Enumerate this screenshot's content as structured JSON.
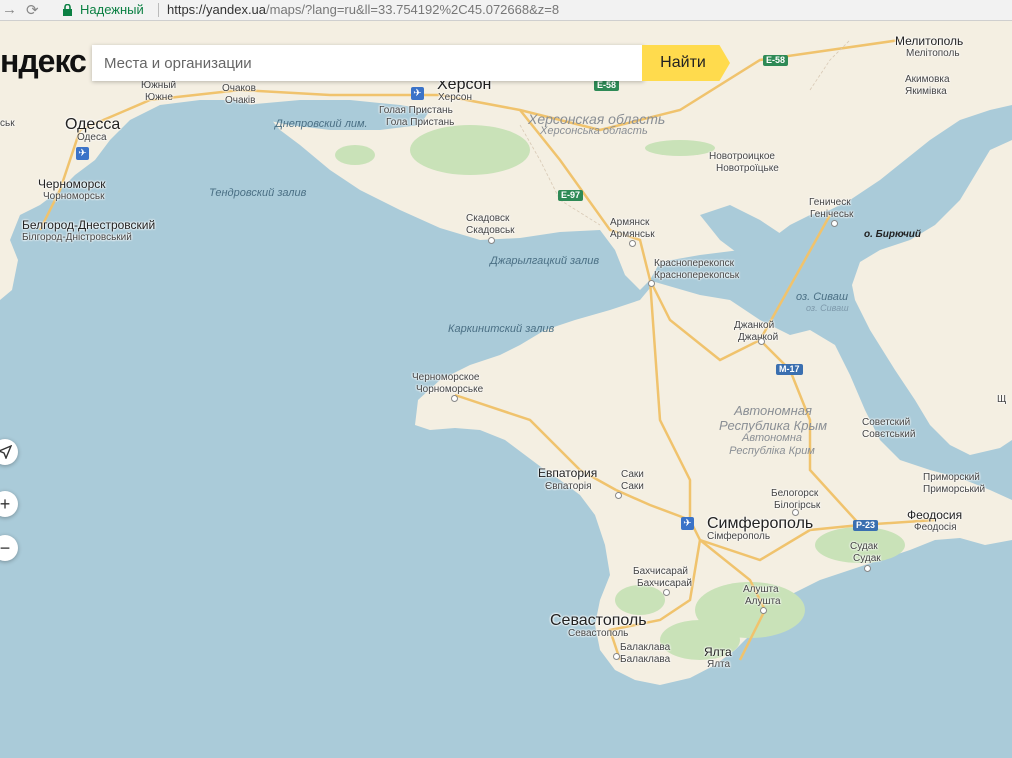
{
  "browser": {
    "security_label": "Надежный",
    "url_host": "https://yandex.ua",
    "url_path": "/maps/?lang=ru&ll=33.754192%2C45.072668&z=8"
  },
  "search": {
    "logo": "ндекс",
    "placeholder": "Места и организации",
    "button_label": "Найти"
  },
  "controls": {
    "geolocate_icon": "arrow-icon",
    "zoom_in_label": "+",
    "zoom_out_label": "−"
  },
  "cities": [
    {
      "name": "Одесса",
      "alt": "Одеса"
    },
    {
      "name": "Черноморск",
      "alt": "Чорноморськ"
    },
    {
      "name": "Белгород-Днестровский",
      "alt": "Білгород-Дністровський"
    },
    {
      "name": "Южный",
      "alt": "Южне"
    },
    {
      "name": "Очаков",
      "alt": "Очаків"
    },
    {
      "name": "Херсон",
      "alt": "Херсон"
    },
    {
      "name": "Голая Пристань",
      "alt": "Гола Пристань"
    },
    {
      "name": "Скадовск",
      "alt": "Скадовськ"
    },
    {
      "name": "Армянск",
      "alt": "Армянськ"
    },
    {
      "name": "Красноперекопск",
      "alt": "Красноперекопськ"
    },
    {
      "name": "Новотроицкое",
      "alt": "Новотроїцьке"
    },
    {
      "name": "Геническ",
      "alt": "Генічеськ"
    },
    {
      "name": "Мелитополь",
      "alt": "Мелітополь"
    },
    {
      "name": "Акимовка",
      "alt": "Якимівка"
    },
    {
      "name": "Джанкой",
      "alt": "Джанкой"
    },
    {
      "name": "Черноморское",
      "alt": "Чорноморське"
    },
    {
      "name": "Евпатория",
      "alt": "Євпаторія"
    },
    {
      "name": "Саки",
      "alt": "Саки"
    },
    {
      "name": "Симферополь",
      "alt": "Сімферополь"
    },
    {
      "name": "Белогорск",
      "alt": "Білогірськ"
    },
    {
      "name": "Советский",
      "alt": "Совєтський"
    },
    {
      "name": "Приморский",
      "alt": "Приморський"
    },
    {
      "name": "Феодосия",
      "alt": "Феодосія"
    },
    {
      "name": "Судак",
      "alt": "Судак"
    },
    {
      "name": "Бахчисарай",
      "alt": "Бахчисарай"
    },
    {
      "name": "Алушта",
      "alt": "Алушта"
    },
    {
      "name": "Севастополь",
      "alt": "Севастополь"
    },
    {
      "name": "Балаклава",
      "alt": "Балаклава"
    },
    {
      "name": "Ялта",
      "alt": "Ялта"
    }
  ],
  "partial_labels": [
    "ськ",
    "Щ"
  ],
  "water": [
    "Днепровский лим.",
    "Тендровский залив",
    "Джарылгацкий залив",
    "Каркинитский залив",
    "оз. Сиваш",
    "оз. Сиваш",
    "о. Бирючий"
  ],
  "regions": [
    {
      "name": "Херсонская область",
      "alt": "Херсонська область"
    },
    {
      "name": "Автономная Республика Крым",
      "alt": "Автономна Республіка Крим"
    }
  ],
  "roads": [
    "E-58",
    "E-58",
    "E-97",
    "M-17",
    "P-23"
  ]
}
